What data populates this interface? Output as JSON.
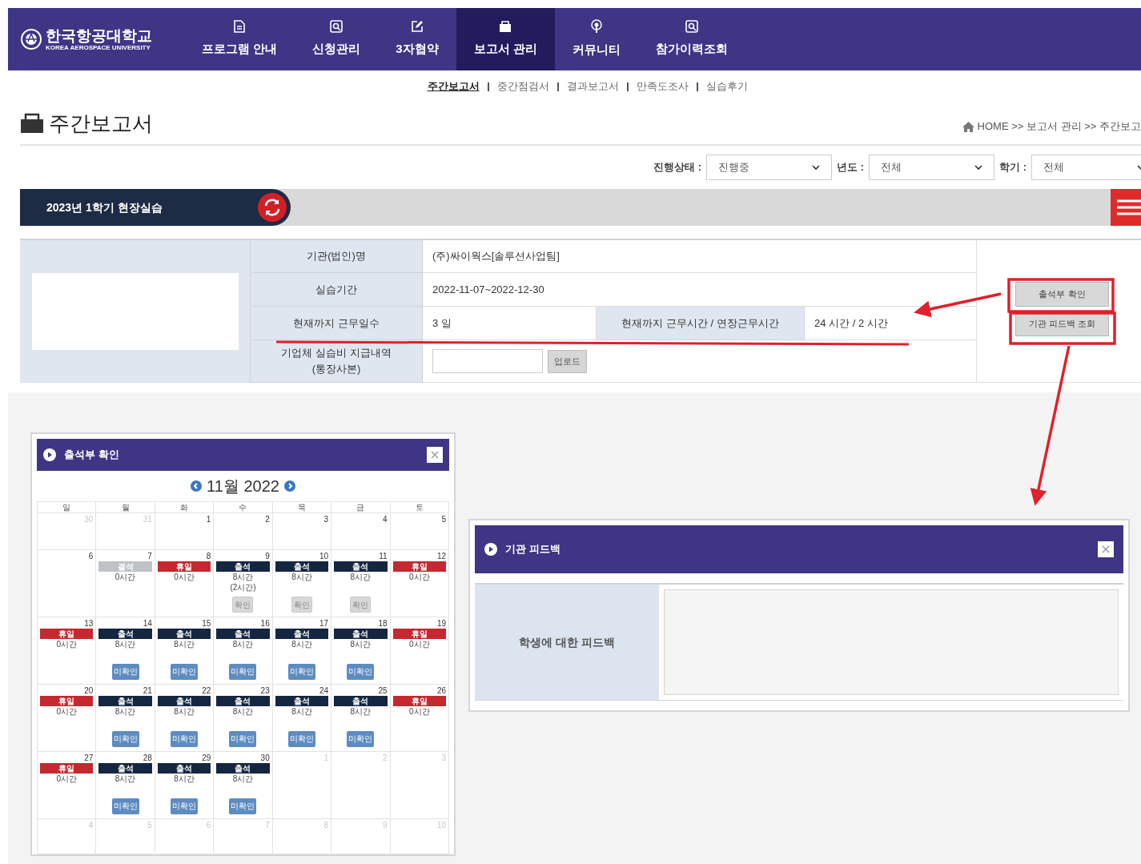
{
  "header": {
    "logo_text": "한국항공대학교",
    "logo_subtext": "KOREA AEROSPACE UNIVERSITY",
    "menu": [
      {
        "label": "프로그램 안내",
        "kind": "document",
        "selected": false
      },
      {
        "label": "신청관리",
        "kind": "search",
        "selected": false
      },
      {
        "label": "3자협약",
        "kind": "edit",
        "selected": false
      },
      {
        "label": "보고서 관리",
        "kind": "folder",
        "selected": true
      },
      {
        "label": "커뮤니티",
        "kind": "broadcast",
        "selected": false
      },
      {
        "label": "참가이력조회",
        "kind": "search",
        "selected": false
      }
    ]
  },
  "subnav": [
    {
      "label": "주간보고서",
      "selected": true
    },
    {
      "label": "중간점검서",
      "selected": false
    },
    {
      "label": "결과보고서",
      "selected": false
    },
    {
      "label": "만족도조사",
      "selected": false
    },
    {
      "label": "실습후기",
      "selected": false
    }
  ],
  "page_title": "주간보고서",
  "breadcrumb": "HOME >>  보고서 관리 >> 주간보고",
  "filters": [
    {
      "label": "진행상태 :",
      "value": "진행중"
    },
    {
      "label": "년도 :",
      "value": "전체"
    },
    {
      "label": "학기 :",
      "value": "전체"
    }
  ],
  "course_tab": "2023년 1학기 현장실습",
  "info": {
    "org_label": "기관(법인)명",
    "org": "(주)싸이웍스[솔루션사업팀]",
    "period_label": "실습기간",
    "period": "2022-11-07~2022-12-30",
    "days_label": "현재까지 근무일수",
    "days": "3 일",
    "hours_label": "현재까지 근무시간 / 연장근무시간",
    "hours": "24 시간 / 2 시간",
    "payment_label": [
      "기업체 실습비 지급내역",
      "(통장사본)"
    ],
    "upload_button": "업로드"
  },
  "side_buttons": [
    "출석부 확인",
    "기관 피드백 조회"
  ],
  "attendance_popup": {
    "title": "출석부 확인",
    "month": "11월 2022",
    "weekdays": [
      "일",
      "월",
      "화",
      "수",
      "목",
      "금",
      "토"
    ],
    "weeks": [
      [
        {
          "date": "30",
          "in_month": false
        },
        {
          "date": "31",
          "in_month": false
        },
        {
          "date": "1",
          "in_month": true
        },
        {
          "date": "2",
          "in_month": true
        },
        {
          "date": "3",
          "in_month": true
        },
        {
          "date": "4",
          "in_month": true
        },
        {
          "date": "5",
          "in_month": true
        }
      ],
      [
        {
          "date": "6",
          "in_month": true
        },
        {
          "date": "7",
          "in_month": true,
          "badge": {
            "kind": "absent",
            "label": "결석"
          },
          "hours": "0시간"
        },
        {
          "date": "8",
          "in_month": true,
          "badge": {
            "kind": "holiday",
            "label": "휴일"
          },
          "hours": "0시간"
        },
        {
          "date": "9",
          "in_month": true,
          "badge": {
            "kind": "present",
            "label": "출석"
          },
          "hours": "8시간",
          "note": "(2시간)",
          "button": {
            "kind": "confirmed",
            "label": "확인"
          }
        },
        {
          "date": "10",
          "in_month": true,
          "badge": {
            "kind": "present",
            "label": "출석"
          },
          "hours": "8시간",
          "button": {
            "kind": "confirmed",
            "label": "확인"
          }
        },
        {
          "date": "11",
          "in_month": true,
          "badge": {
            "kind": "present",
            "label": "출석"
          },
          "hours": "8시간",
          "button": {
            "kind": "confirmed",
            "label": "확인"
          }
        },
        {
          "date": "12",
          "in_month": true,
          "badge": {
            "kind": "holiday",
            "label": "휴일"
          },
          "hours": "0시간"
        }
      ],
      [
        {
          "date": "13",
          "in_month": true,
          "badge": {
            "kind": "holiday",
            "label": "휴일"
          },
          "hours": "0시간"
        },
        {
          "date": "14",
          "in_month": true,
          "badge": {
            "kind": "present",
            "label": "출석"
          },
          "hours": "8시간",
          "button": {
            "kind": "unconfirmed",
            "label": "미확인"
          }
        },
        {
          "date": "15",
          "in_month": true,
          "badge": {
            "kind": "present",
            "label": "출석"
          },
          "hours": "8시간",
          "button": {
            "kind": "unconfirmed",
            "label": "미확인"
          }
        },
        {
          "date": "16",
          "in_month": true,
          "badge": {
            "kind": "present",
            "label": "출석"
          },
          "hours": "8시간",
          "button": {
            "kind": "unconfirmed",
            "label": "미확인"
          }
        },
        {
          "date": "17",
          "in_month": true,
          "badge": {
            "kind": "present",
            "label": "출석"
          },
          "hours": "8시간",
          "button": {
            "kind": "unconfirmed",
            "label": "미확인"
          }
        },
        {
          "date": "18",
          "in_month": true,
          "badge": {
            "kind": "present",
            "label": "출석"
          },
          "hours": "8시간",
          "button": {
            "kind": "unconfirmed",
            "label": "미확인"
          }
        },
        {
          "date": "19",
          "in_month": true,
          "badge": {
            "kind": "holiday",
            "label": "휴일"
          },
          "hours": "0시간"
        }
      ],
      [
        {
          "date": "20",
          "in_month": true,
          "badge": {
            "kind": "holiday",
            "label": "휴일"
          },
          "hours": "0시간"
        },
        {
          "date": "21",
          "in_month": true,
          "badge": {
            "kind": "present",
            "label": "출석"
          },
          "hours": "8시간",
          "button": {
            "kind": "unconfirmed",
            "label": "미확인"
          }
        },
        {
          "date": "22",
          "in_month": true,
          "badge": {
            "kind": "present",
            "label": "출석"
          },
          "hours": "8시간",
          "button": {
            "kind": "unconfirmed",
            "label": "미확인"
          }
        },
        {
          "date": "23",
          "in_month": true,
          "badge": {
            "kind": "present",
            "label": "출석"
          },
          "hours": "8시간",
          "button": {
            "kind": "unconfirmed",
            "label": "미확인"
          }
        },
        {
          "date": "24",
          "in_month": true,
          "badge": {
            "kind": "present",
            "label": "출석"
          },
          "hours": "8시간",
          "button": {
            "kind": "unconfirmed",
            "label": "미확인"
          }
        },
        {
          "date": "25",
          "in_month": true,
          "badge": {
            "kind": "present",
            "label": "출석"
          },
          "hours": "8시간",
          "button": {
            "kind": "unconfirmed",
            "label": "미확인"
          }
        },
        {
          "date": "26",
          "in_month": true,
          "badge": {
            "kind": "holiday",
            "label": "휴일"
          },
          "hours": "0시간"
        }
      ],
      [
        {
          "date": "27",
          "in_month": true,
          "badge": {
            "kind": "holiday",
            "label": "휴일"
          },
          "hours": "0시간"
        },
        {
          "date": "28",
          "in_month": true,
          "badge": {
            "kind": "present",
            "label": "출석"
          },
          "hours": "8시간",
          "button": {
            "kind": "unconfirmed",
            "label": "미확인"
          }
        },
        {
          "date": "29",
          "in_month": true,
          "badge": {
            "kind": "present",
            "label": "출석"
          },
          "hours": "8시간",
          "button": {
            "kind": "unconfirmed",
            "label": "미확인"
          }
        },
        {
          "date": "30",
          "in_month": true,
          "badge": {
            "kind": "present",
            "label": "출석"
          },
          "hours": "8시간",
          "button": {
            "kind": "unconfirmed",
            "label": "미확인"
          }
        },
        {
          "date": "1",
          "in_month": false
        },
        {
          "date": "2",
          "in_month": false
        },
        {
          "date": "3",
          "in_month": false
        }
      ],
      [
        {
          "date": "4",
          "in_month": false
        },
        {
          "date": "5",
          "in_month": false
        },
        {
          "date": "6",
          "in_month": false
        },
        {
          "date": "7",
          "in_month": false
        },
        {
          "date": "8",
          "in_month": false
        },
        {
          "date": "9",
          "in_month": false
        },
        {
          "date": "10",
          "in_month": false
        }
      ]
    ]
  },
  "feedback_popup": {
    "title": "기관 피드백",
    "label": "학생에 대한 피드백"
  }
}
